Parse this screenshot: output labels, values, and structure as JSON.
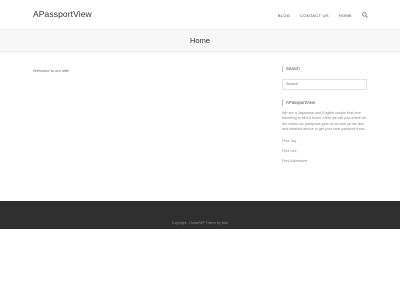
{
  "site": {
    "logo": "APassportView"
  },
  "nav": {
    "items": [
      "BLOG",
      "CONTACT US",
      "HOME"
    ]
  },
  "banner": {
    "title": "Home"
  },
  "main": {
    "welcome": "Welcome to our site!"
  },
  "sidebar": {
    "search_title": "Search",
    "search_placeholder": "Search",
    "about_title": "APassportView",
    "about_text": "We are a Japanese and English couple that love travelling in all it's forms. Here we will you where all the views our passports give us as well as the tips and detailed advice to get your best passport trave.",
    "links": [
      "Find Joy",
      "Find Life",
      "Find Adventure"
    ]
  },
  "footer": {
    "text": "Copyright - OceanWP Theme by Nick"
  }
}
